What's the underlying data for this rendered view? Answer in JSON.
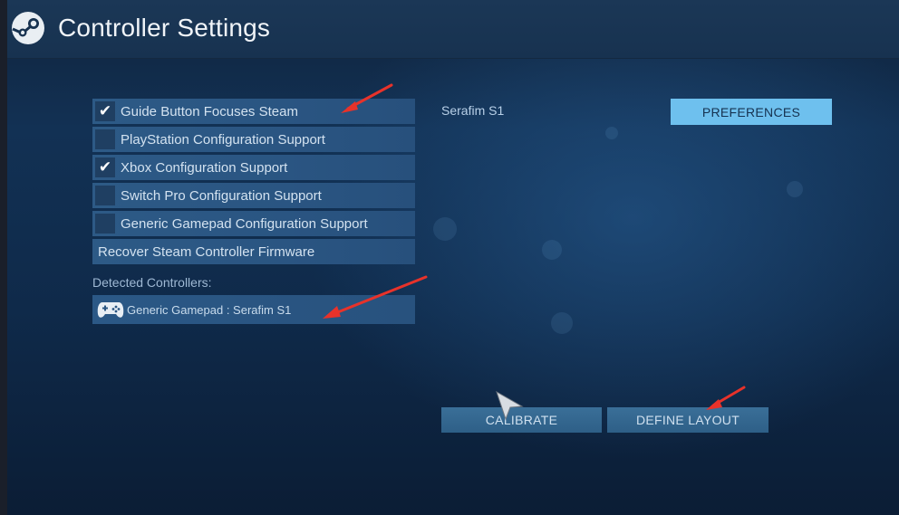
{
  "window": {
    "title": "Controller Settings"
  },
  "options": [
    {
      "label": "Guide Button Focuses Steam",
      "checked": true,
      "type": "checkbox"
    },
    {
      "label": "PlayStation Configuration Support",
      "checked": false,
      "type": "checkbox"
    },
    {
      "label": "Xbox Configuration Support",
      "checked": true,
      "type": "checkbox"
    },
    {
      "label": "Switch Pro Configuration Support",
      "checked": false,
      "type": "checkbox"
    },
    {
      "label": "Generic Gamepad Configuration Support",
      "checked": false,
      "type": "checkbox"
    },
    {
      "label": "Recover Steam Controller Firmware",
      "type": "action"
    }
  ],
  "detected": {
    "section_label": "Detected Controllers:",
    "controllers": [
      {
        "label": "Generic Gamepad : Serafim S1",
        "icon": "gamepad-icon"
      }
    ]
  },
  "selected_controller": {
    "name": "Serafim S1",
    "preferences_label": "PREFERENCES"
  },
  "actions": {
    "calibrate_label": "CALIBRATE",
    "define_layout_label": "DEFINE LAYOUT"
  },
  "colors": {
    "accent_button": "#6ec0ee",
    "annotation_arrow": "#e8322a"
  }
}
